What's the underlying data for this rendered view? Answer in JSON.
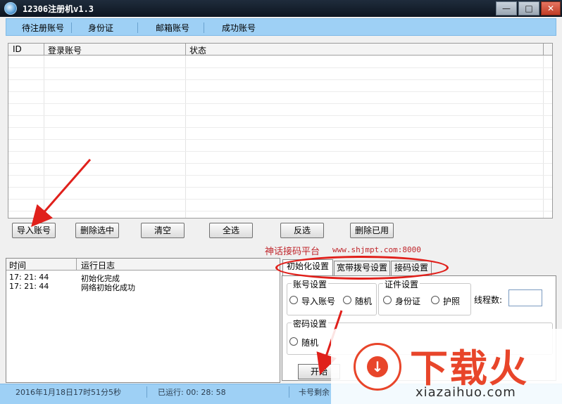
{
  "window": {
    "title": "12306注册机v1.3",
    "minimize": "—",
    "maximize": "□",
    "close": "✕"
  },
  "nav": {
    "tabs": [
      "待注册账号",
      "身份证",
      "邮箱账号",
      "成功账号"
    ]
  },
  "grid": {
    "columns": [
      "ID",
      "登录账号",
      "状态"
    ]
  },
  "buttons": {
    "import": "导入账号",
    "delete_selected": "删除选中",
    "clear": "清空",
    "select_all": "全选",
    "invert": "反选",
    "delete_used": "删除已用"
  },
  "platform": {
    "name": "神话接码平台",
    "url": "www.shjmpt.com:8000"
  },
  "log": {
    "columns": [
      "时间",
      "运行日志"
    ],
    "rows": [
      {
        "time": "17: 21: 44",
        "message": "初始化完成"
      },
      {
        "time": "17: 21: 44",
        "message": "网络初始化成功"
      }
    ]
  },
  "settings": {
    "tabs": [
      "初始化设置",
      "宽带拨号设置",
      "接码设置"
    ],
    "account_group": {
      "title": "账号设置",
      "options": [
        "导入账号",
        "随机"
      ]
    },
    "id_group": {
      "title": "证件设置",
      "options": [
        "身份证",
        "护照"
      ]
    },
    "thread_label": "线程数:",
    "password_group": {
      "title": "密码设置",
      "options": [
        "随机"
      ]
    },
    "start": "开始"
  },
  "status": {
    "date": "2016年1月18日17时51分5秒",
    "runtime": "已运行: 00: 28: 58",
    "balance": "卡号剩余"
  },
  "watermark": {
    "brand": "下载火",
    "url": "xiazaihuo.com"
  },
  "colors": {
    "accent_blue": "#9ed0f5",
    "annotation_red": "#e0201b",
    "brand_orange": "#e8452a"
  }
}
